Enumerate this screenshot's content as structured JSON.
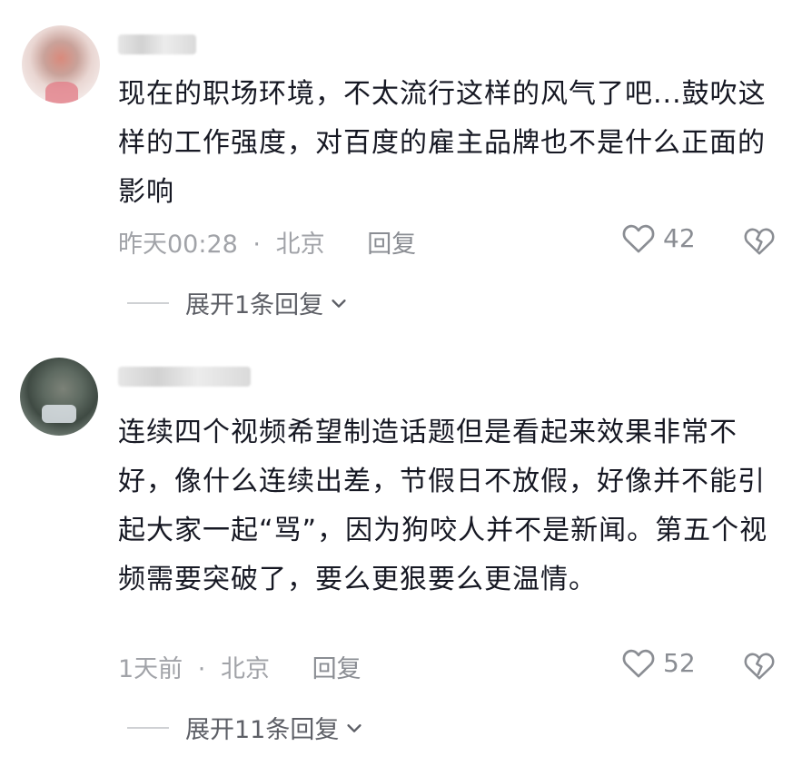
{
  "comments": [
    {
      "content": "现在的职场环境，不太流行这样的风气了吧...鼓吹这样的工作强度，对百度的雇主品牌也不是什么正面的影响",
      "time": "昨天00:28",
      "separator": "·",
      "location": "北京",
      "reply_label": "回复",
      "likes": "42",
      "expand_label": "展开1条回复",
      "avatar_icon": "blurred-avatar",
      "username_blurred": true
    },
    {
      "content": "连续四个视频希望制造话题但是看起来效果非常不好，像什么连续出差，节假日不放假，好像并不能引起大家一起“骂”，因为狗咬人并不是新闻。第五个视频需要突破了，要么更狠要么更温情。",
      "time": "1天前",
      "separator": "·",
      "location": "北京",
      "reply_label": "回复",
      "likes": "52",
      "expand_label": "展开11条回复",
      "avatar_icon": "blurred-avatar",
      "username_blurred": true
    }
  ],
  "icons": {
    "like": "heart-outline-icon",
    "dislike": "broken-heart-icon",
    "expand": "chevron-down-icon"
  },
  "colors": {
    "text": "#161823",
    "meta": "#a1a3a8",
    "action": "#8a8d93"
  }
}
